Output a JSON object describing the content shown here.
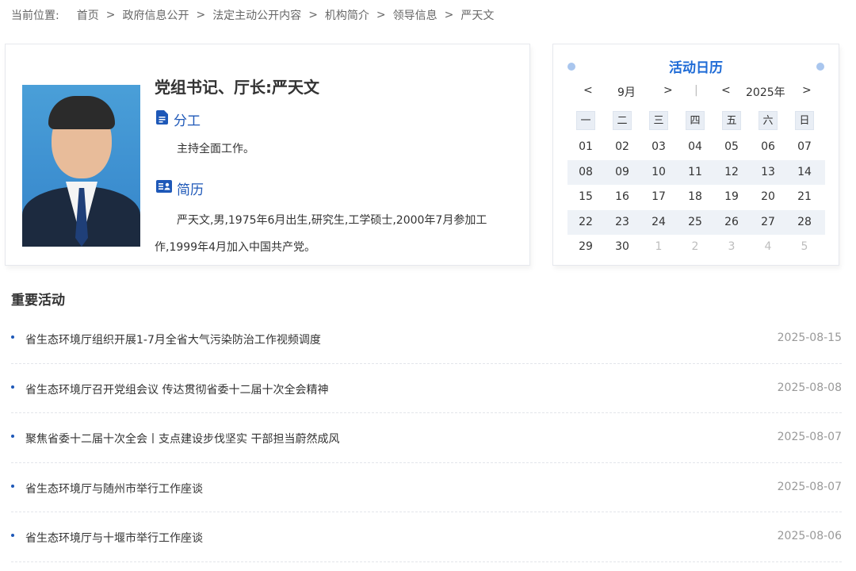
{
  "breadcrumb": {
    "label": "当前位置:",
    "items": [
      "首页",
      "政府信息公开",
      "法定主动公开内容",
      "机构简介",
      "领导信息",
      "严天文"
    ],
    "separator": ">"
  },
  "leader": {
    "title": "党组书记、厅长:严天文",
    "duty_heading": "分工",
    "duty_text": "主持全面工作。",
    "resume_heading": "简历",
    "resume_text": "严天文,男,1975年6月出生,研究生,工学硕士,2000年7月参加工作,1999年4月加入中国共产党。"
  },
  "calendar": {
    "title": "活动日历",
    "prev_month": "<",
    "month": "9月",
    "next_month": ">",
    "divider": "|",
    "prev_year": "<",
    "year": "2025年",
    "next_year": ">",
    "weekdays": [
      "一",
      "二",
      "三",
      "四",
      "五",
      "六",
      "日"
    ],
    "weeks": [
      [
        "01",
        "02",
        "03",
        "04",
        "05",
        "06",
        "07"
      ],
      [
        "08",
        "09",
        "10",
        "11",
        "12",
        "13",
        "14"
      ],
      [
        "15",
        "16",
        "17",
        "18",
        "19",
        "20",
        "21"
      ],
      [
        "22",
        "23",
        "24",
        "25",
        "26",
        "27",
        "28"
      ],
      [
        "29",
        "30",
        "1",
        "2",
        "3",
        "4",
        "5"
      ]
    ],
    "accent_color": "#1e6bd6"
  },
  "activities": {
    "title": "重要活动",
    "items": [
      {
        "text": "省生态环境厅组织开展1-7月全省大气污染防治工作视频调度",
        "date": "2025-08-15"
      },
      {
        "text": "省生态环境厅召开党组会议 传达贯彻省委十二届十次全会精神",
        "date": "2025-08-08"
      },
      {
        "text": "聚焦省委十二届十次全会丨支点建设步伐坚实 干部担当蔚然成风",
        "date": "2025-08-07"
      },
      {
        "text": "省生态环境厅与随州市举行工作座谈",
        "date": "2025-08-07"
      },
      {
        "text": "省生态环境厅与十堰市举行工作座谈",
        "date": "2025-08-06"
      }
    ]
  },
  "icons": {
    "duty_icon": "document-icon",
    "resume_icon": "id-card-icon"
  }
}
